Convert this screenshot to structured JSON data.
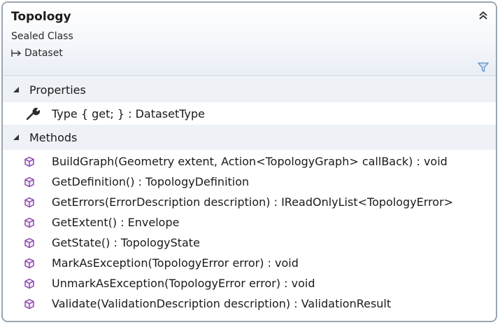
{
  "class": {
    "name": "Topology",
    "kind": "Sealed Class",
    "base": "Dataset"
  },
  "sections": {
    "properties": {
      "label": "Properties",
      "items": [
        {
          "text": "Type { get; } : DatasetType",
          "icon": "wrench-icon"
        }
      ]
    },
    "methods": {
      "label": "Methods",
      "items": [
        {
          "text": "BuildGraph(Geometry extent, Action<TopologyGraph> callBack) : void",
          "icon": "method-cube-icon"
        },
        {
          "text": "GetDefinition() : TopologyDefinition",
          "icon": "method-cube-icon"
        },
        {
          "text": "GetErrors(ErrorDescription description) : IReadOnlyList<TopologyError>",
          "icon": "method-cube-icon"
        },
        {
          "text": "GetExtent() : Envelope",
          "icon": "method-cube-icon"
        },
        {
          "text": "GetState() : TopologyState",
          "icon": "method-cube-icon"
        },
        {
          "text": "MarkAsException(TopologyError error) : void",
          "icon": "method-cube-icon"
        },
        {
          "text": "UnmarkAsException(TopologyError error) : void",
          "icon": "method-cube-icon"
        },
        {
          "text": "Validate(ValidationDescription description) : ValidationResult",
          "icon": "method-cube-icon"
        }
      ]
    }
  },
  "colors": {
    "border": "#9aa6b4",
    "section_bg": "#eef1f6",
    "method_icon": "#8a3fa8",
    "filter_icon": "#5b8fc9"
  }
}
